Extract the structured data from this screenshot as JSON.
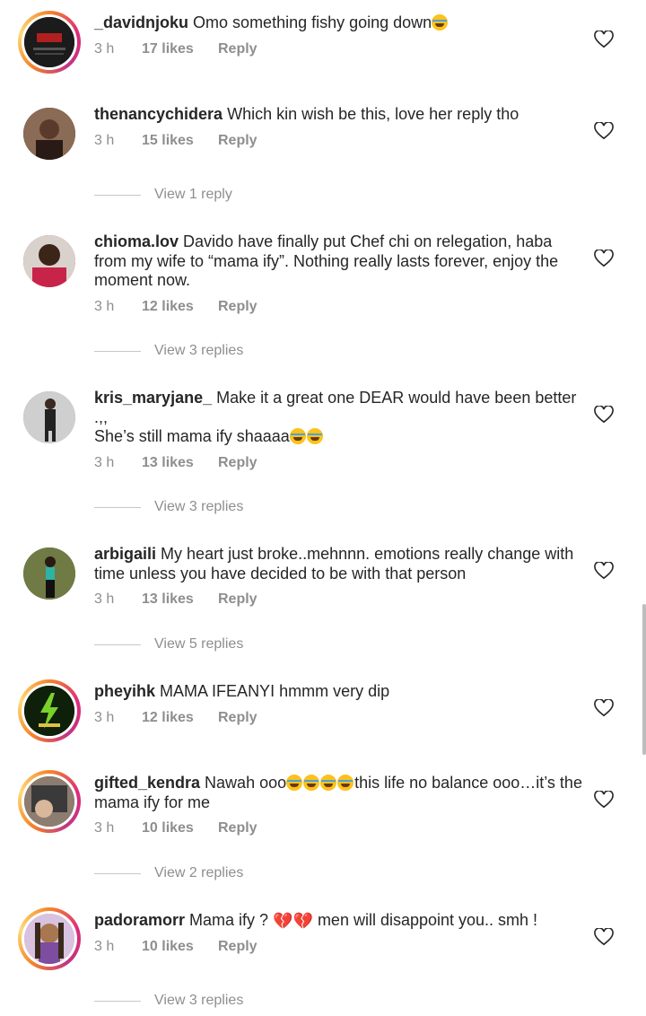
{
  "actions": {
    "reply_label": "Reply"
  },
  "colors": {
    "text": "#262626",
    "meta": "#8e8e8e",
    "story_ring": "#dd2a7b"
  },
  "comments": [
    {
      "username": "_davidnjoku",
      "text": "Omo something fishy going down",
      "emoji_count": 1,
      "time": "3 h",
      "likes": "17 likes",
      "replies": "",
      "avatar_bg": "#2b2b2b",
      "avatar_label": "SPEAKOUT"
    },
    {
      "username": "thenancychidera",
      "text": "Which kin wish be this, love her reply tho",
      "time": "3 h",
      "likes": "15 likes",
      "replies": "View 1 reply",
      "avatar_bg": "#3a2a26"
    },
    {
      "username": "chioma.lov",
      "text": "Davido have finally put Chef chi on relegation, haba from my wife to “mama ify”. Nothing really lasts forever, enjoy the moment now.",
      "time": "3 h",
      "likes": "12 likes",
      "replies": "View 3 replies",
      "avatar_bg": "#b5294a"
    },
    {
      "username": "kris_maryjane_",
      "text": "Make it a great one DEAR would have been better .,,",
      "text2": "She’s still mama ify shaaaa",
      "time": "3 h",
      "likes": "13 likes",
      "replies": "View 3 replies",
      "avatar_bg": "#9c9c9c"
    },
    {
      "username": "arbigaili",
      "text": "My heart just broke..mehnnn. emotions really change with time unless you have decided to be with that person",
      "time": "3 h",
      "likes": "13 likes",
      "replies": "View 5 replies",
      "avatar_bg": "#5e6b3a"
    },
    {
      "username": "pheyihk",
      "text": "MAMA IFEANYI hmmm very dip",
      "time": "3 h",
      "likes": "12 likes",
      "replies": "",
      "avatar_bg": "#1f3a12"
    },
    {
      "username": "gifted_kendra",
      "text": "Nawah ooo",
      "text_after": "this life no balance ooo…it’s the mama ify for me",
      "time": "3 h",
      "likes": "10 likes",
      "replies": "View 2 replies",
      "avatar_bg": "#6f6259"
    },
    {
      "username": "padoramorr",
      "text": "Mama ify ?",
      "text_after": "men will disappoint you.. smh !",
      "time": "3 h",
      "likes": "10 likes",
      "replies": "View 3 replies",
      "avatar_bg": "#c7a6c9"
    }
  ]
}
